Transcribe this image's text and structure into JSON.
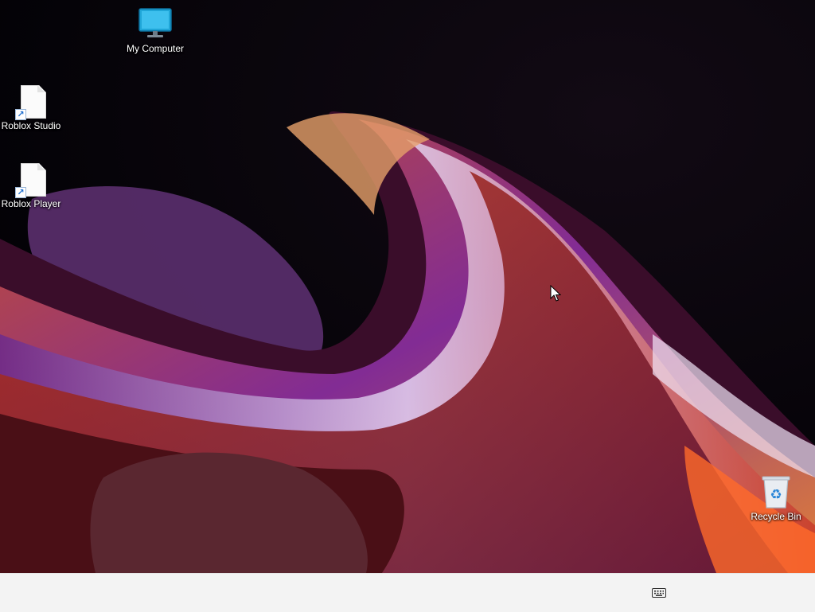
{
  "desktop": {
    "icons": [
      {
        "label": "My Computer",
        "icon": "monitor-icon"
      },
      {
        "label": "Roblox Studio",
        "icon": "shortcut-file-icon"
      },
      {
        "label": "Roblox Player",
        "icon": "shortcut-file-icon"
      },
      {
        "label": "Recycle Bin",
        "icon": "recycle-bin-icon"
      }
    ]
  },
  "taskbar": {
    "tray_icon": "keyboard-icon"
  },
  "colors": {
    "taskbar_bg": "#f3f3f3",
    "wallpaper_dark": "#05030a",
    "monitor_blue": "#1fa6d8"
  }
}
